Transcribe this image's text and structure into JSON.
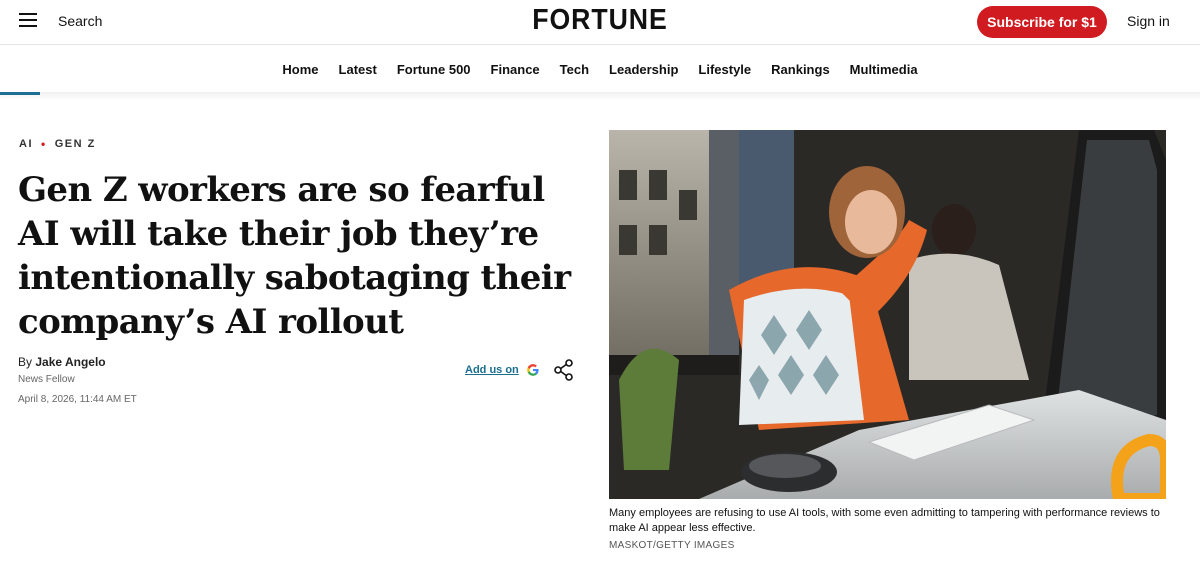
{
  "header": {
    "search_label": "Search",
    "logo": "FORTUNE",
    "subscribe_label": "Subscribe for $1",
    "signin_label": "Sign in",
    "brand_color": "#d01b20"
  },
  "nav": {
    "items": [
      "Home",
      "Latest",
      "Fortune 500",
      "Finance",
      "Tech",
      "Leadership",
      "Lifestyle",
      "Rankings",
      "Multimedia"
    ]
  },
  "reading_progress": 0.033,
  "article": {
    "tags": [
      "AI",
      "GEN Z"
    ],
    "headline": "Gen Z workers are so fearful AI will take their job they’re intentionally sabotaging their company’s AI rollout",
    "byline_prefix": "By",
    "author": "Jake Angelo",
    "author_role": "News Fellow",
    "date": "April 8, 2026, 11:44 AM ET",
    "add_us_label": "Add us on",
    "image_caption": "Many employees are refusing to use AI tools, with some even admitting to tampering with performance reviews to make AI appear less effective.",
    "image_credit": "MASKOT/GETTY IMAGES"
  }
}
